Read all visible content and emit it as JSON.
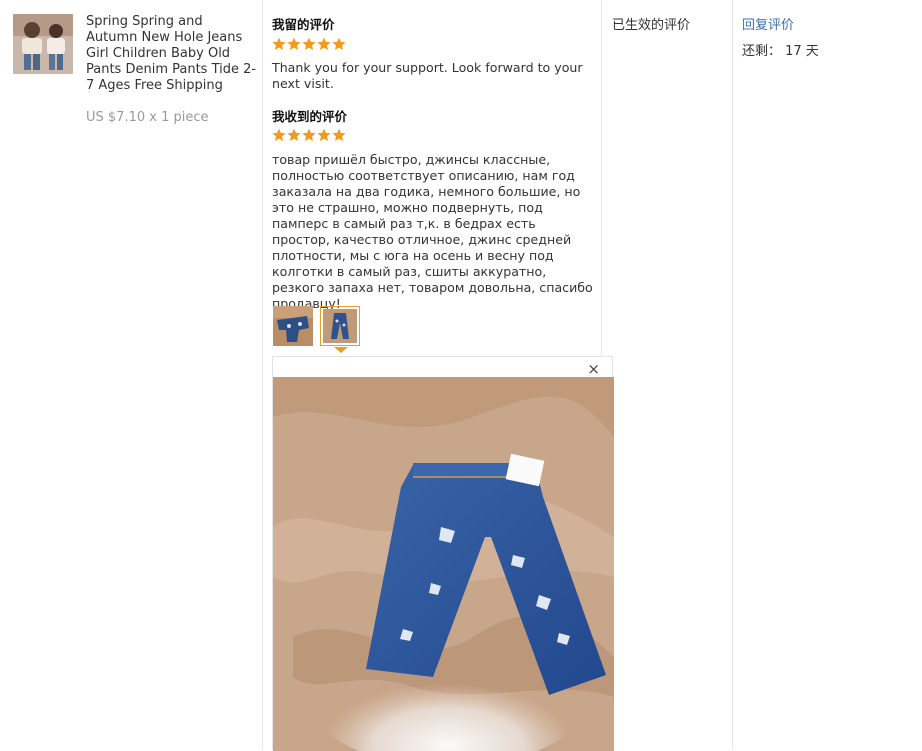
{
  "product": {
    "title": "Spring Spring and Autumn New Hole Jeans Girl Children Baby Old Pants Denim Pants Tide 2-7 Ages Free Shipping",
    "price": "US $7.10 x 1 piece"
  },
  "my_review": {
    "heading": "我留的评价",
    "rating": 5,
    "text": "Thank you for your support. Look forward to your next visit."
  },
  "received_review": {
    "heading": "我收到的评价",
    "rating": 5,
    "text": "товар пришёл быстро, джинсы классные, полностью соответствует описанию, нам год заказала на два годика, немного большие, но это не страшно, можно подвернуть, под памперс в самый раз т,к. в бедрах есть простор, качество отличное, джинс средней плотности, мы с юга на осень и весну под колготки в самый раз, сшиты аккуратно, резкого запаха нет, товаром довольна, спасибо продавцу!"
  },
  "preview": {
    "close": "×"
  },
  "status": {
    "valid_label": "已生效的评价"
  },
  "actions": {
    "reply": "回复评价",
    "remaining": "还剩： 17 天"
  },
  "colors": {
    "star": "#f39a1a",
    "link": "#3a70b0",
    "selected_border": "#e6a02a"
  }
}
